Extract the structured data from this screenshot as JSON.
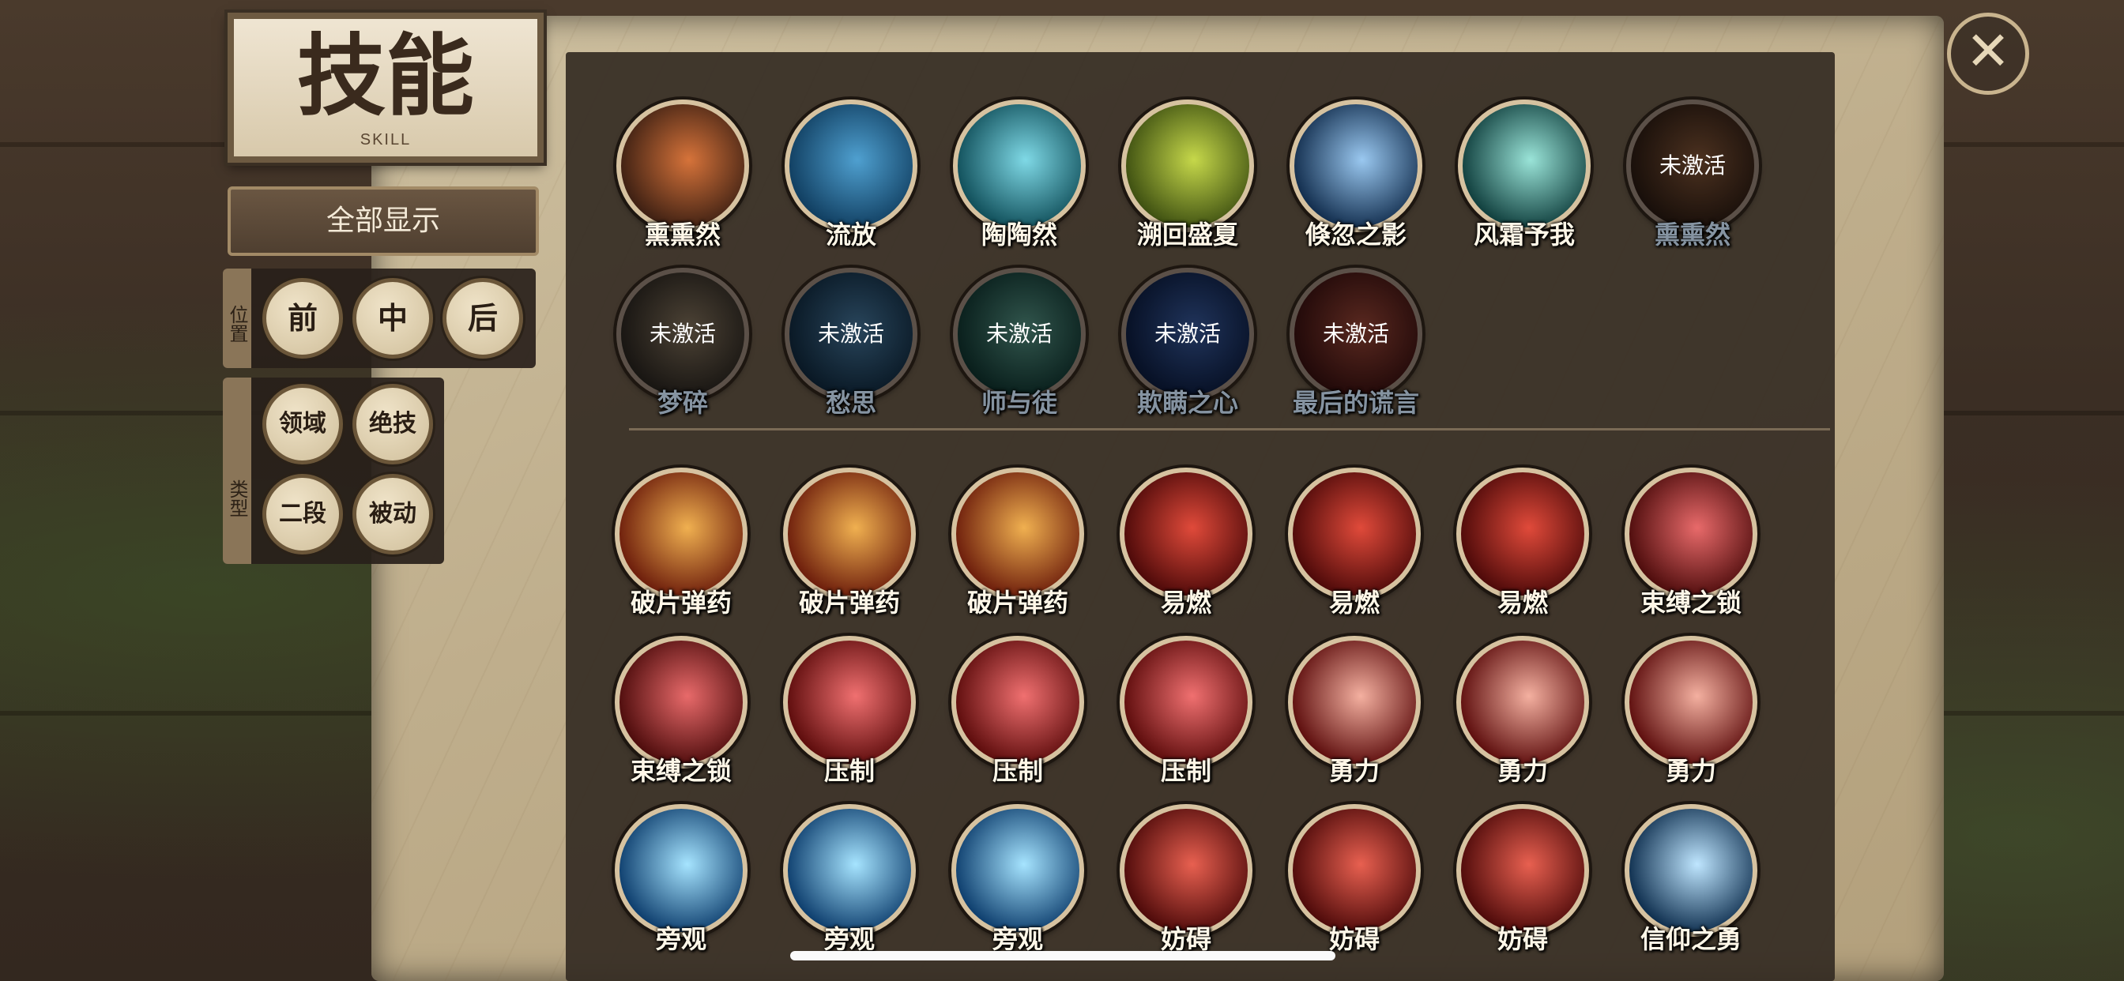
{
  "header": {
    "title": "技能",
    "subtitle": "SKILL"
  },
  "filters": {
    "show_all_label": "全部显示",
    "position": {
      "label": "位置",
      "options": [
        "前",
        "中",
        "后"
      ]
    },
    "type": {
      "label": "类型",
      "options": [
        "领域",
        "绝技",
        "二段",
        "被动"
      ]
    }
  },
  "locked_text": "未激活",
  "close_icon": "close-icon",
  "hero_skills": [
    {
      "name": "熏熏然",
      "locked": false,
      "colors": [
        "#3a1e12",
        "#d6733a"
      ]
    },
    {
      "name": "流放",
      "locked": false,
      "colors": [
        "#0f3c5e",
        "#4fa0d0"
      ]
    },
    {
      "name": "陶陶然",
      "locked": false,
      "colors": [
        "#0e4c57",
        "#7fd9e6"
      ]
    },
    {
      "name": "溯回盛夏",
      "locked": false,
      "colors": [
        "#3b4d10",
        "#c6d84a"
      ]
    },
    {
      "name": "倏忽之影",
      "locked": false,
      "colors": [
        "#0f2a4a",
        "#9ac8f0"
      ]
    },
    {
      "name": "风霜予我",
      "locked": false,
      "colors": [
        "#0d3b3a",
        "#9ae4d8"
      ]
    },
    {
      "name": "熏熏然",
      "locked": true,
      "colors": [
        "#2a1a12",
        "#8a5a3a"
      ]
    },
    {
      "name": "梦碎",
      "locked": true,
      "colors": [
        "#2a2520",
        "#8c7a62"
      ]
    },
    {
      "name": "愁思",
      "locked": true,
      "colors": [
        "#102a40",
        "#4a7ea6"
      ]
    },
    {
      "name": "师与徒",
      "locked": true,
      "colors": [
        "#0f3530",
        "#5a9c8c"
      ]
    },
    {
      "name": "欺瞒之心",
      "locked": true,
      "colors": [
        "#0c1c40",
        "#3b5fa6"
      ]
    },
    {
      "name": "最后的谎言",
      "locked": true,
      "colors": [
        "#3a1010",
        "#a34a3a"
      ]
    }
  ],
  "passive_skills": [
    {
      "name": "破片弹药",
      "colors": [
        "#6a1a0a",
        "#f0b050"
      ]
    },
    {
      "name": "破片弹药",
      "colors": [
        "#6a1a0a",
        "#f0b050"
      ]
    },
    {
      "name": "破片弹药",
      "colors": [
        "#6a1a0a",
        "#f0b050"
      ]
    },
    {
      "name": "易燃",
      "colors": [
        "#4a0808",
        "#e04a3a"
      ]
    },
    {
      "name": "易燃",
      "colors": [
        "#4a0808",
        "#e04a3a"
      ]
    },
    {
      "name": "易燃",
      "colors": [
        "#4a0808",
        "#e04a3a"
      ]
    },
    {
      "name": "束缚之锁",
      "colors": [
        "#4a0a0a",
        "#e86a6a"
      ]
    },
    {
      "name": "束缚之锁",
      "colors": [
        "#4a0a0a",
        "#e86a6a"
      ]
    },
    {
      "name": "压制",
      "colors": [
        "#5a0a0a",
        "#f07070"
      ]
    },
    {
      "name": "压制",
      "colors": [
        "#5a0a0a",
        "#f07070"
      ]
    },
    {
      "name": "压制",
      "colors": [
        "#5a0a0a",
        "#f07070"
      ]
    },
    {
      "name": "勇力",
      "colors": [
        "#5a0a0a",
        "#f4b0a0"
      ]
    },
    {
      "name": "勇力",
      "colors": [
        "#5a0a0a",
        "#f4b0a0"
      ]
    },
    {
      "name": "勇力",
      "colors": [
        "#5a0a0a",
        "#f4b0a0"
      ]
    },
    {
      "name": "旁观",
      "colors": [
        "#0a3a6a",
        "#a6e4ff"
      ]
    },
    {
      "name": "旁观",
      "colors": [
        "#0a3a6a",
        "#a6e4ff"
      ]
    },
    {
      "name": "旁观",
      "colors": [
        "#0a3a6a",
        "#a6e4ff"
      ]
    },
    {
      "name": "妨碍",
      "colors": [
        "#4a0808",
        "#e86050"
      ]
    },
    {
      "name": "妨碍",
      "colors": [
        "#4a0808",
        "#e86050"
      ]
    },
    {
      "name": "妨碍",
      "colors": [
        "#4a0808",
        "#e86050"
      ]
    },
    {
      "name": "信仰之勇",
      "colors": [
        "#0a2a4a",
        "#bfe6ff"
      ]
    }
  ]
}
